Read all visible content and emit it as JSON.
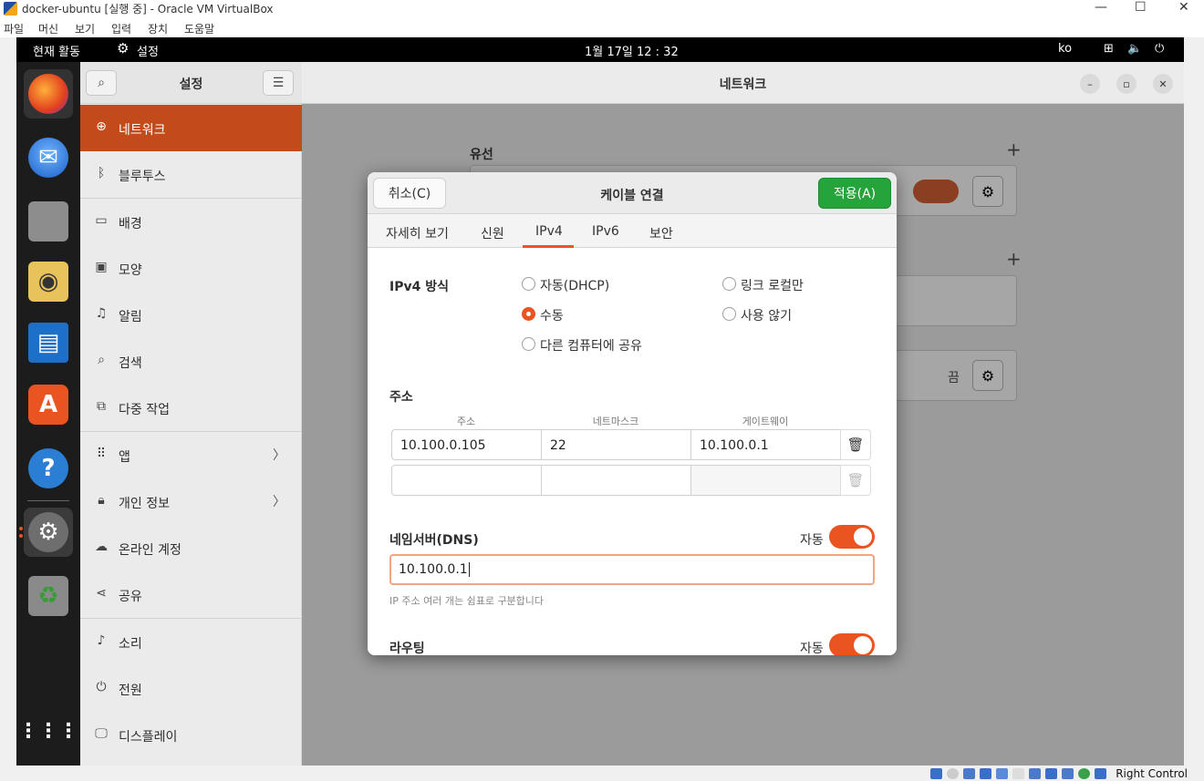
{
  "vbox": {
    "title": "docker-ubuntu [실행 중] - Oracle VM VirtualBox",
    "menu": [
      "파일",
      "머신",
      "보기",
      "입력",
      "장치",
      "도움말"
    ],
    "win_min": "—",
    "win_max": "☐",
    "win_close": "✕",
    "status_right": "Right Control"
  },
  "topbar": {
    "activities": "현재 활동",
    "app": "설정",
    "clock": "1월 17일  12 : 32",
    "lang": "ko"
  },
  "dock": {
    "items": [
      "firefox",
      "thunderbird",
      "files",
      "rhythmbox",
      "libreoffice-writer",
      "app-center",
      "help",
      "settings",
      "trash",
      "show-apps"
    ]
  },
  "sidebar": {
    "title": "설정",
    "items": [
      {
        "label": "네트워크",
        "icon": "network-icon"
      },
      {
        "label": "블루투스",
        "icon": "bluetooth-icon"
      },
      {
        "label": "배경",
        "icon": "background-icon"
      },
      {
        "label": "모양",
        "icon": "appearance-icon"
      },
      {
        "label": "알림",
        "icon": "bell-icon"
      },
      {
        "label": "검색",
        "icon": "search-icon"
      },
      {
        "label": "다중 작업",
        "icon": "multitask-icon"
      },
      {
        "label": "앱",
        "icon": "apps-icon"
      },
      {
        "label": "개인 정보",
        "icon": "lock-icon"
      },
      {
        "label": "온라인 계정",
        "icon": "cloud-icon"
      },
      {
        "label": "공유",
        "icon": "share-icon"
      },
      {
        "label": "소리",
        "icon": "music-icon"
      },
      {
        "label": "전원",
        "icon": "power-icon"
      },
      {
        "label": "디스플레이",
        "icon": "display-icon"
      }
    ]
  },
  "main": {
    "title": "네트워크",
    "wired_label": "유선",
    "off_label": "끔"
  },
  "dialog": {
    "cancel": "취소(C)",
    "title": "케이블 연결",
    "apply": "적용(A)",
    "tabs": [
      "자세히 보기",
      "신원",
      "IPv4",
      "IPv6",
      "보안"
    ],
    "active_tab": "IPv4",
    "method_label": "IPv4 방식",
    "methods": {
      "dhcp": "자동(DHCP)",
      "link_local": "링크 로컬만",
      "manual": "수동",
      "disabled": "사용 않기",
      "shared": "다른 컴퓨터에 공유"
    },
    "selected_method": "수동",
    "address_section": "주소",
    "columns": [
      "주소",
      "네트마스크",
      "게이트웨이"
    ],
    "rows": [
      {
        "address": "10.100.0.105",
        "netmask": "22",
        "gateway": "10.100.0.1"
      },
      {
        "address": "",
        "netmask": "",
        "gateway": ""
      }
    ],
    "dns_label": "네임서버(DNS)",
    "auto_label": "자동",
    "dns_value": "10.100.0.1",
    "dns_hint": "IP 주소 여러 개는 쉼표로 구분합니다",
    "routing_label": "라우팅",
    "routing_auto": "자동"
  },
  "colors": {
    "accent": "#e95420",
    "sidebar_active": "#c34a1a",
    "apply_green": "#26a43c"
  }
}
